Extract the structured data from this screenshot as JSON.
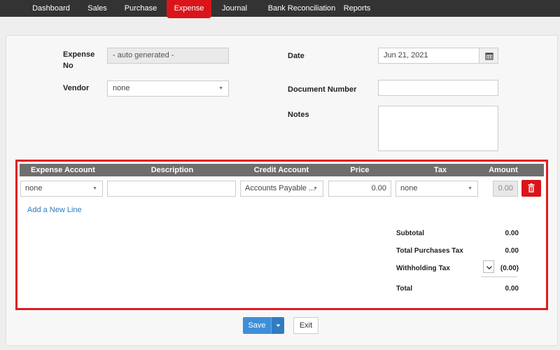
{
  "nav": {
    "items": [
      "Dashboard",
      "Sales",
      "Purchase",
      "Expense",
      "Journal",
      "Bank Reconciliation",
      "Reports"
    ],
    "active": "Expense",
    "active_color": "#d9151b",
    "bar_color": "#333333"
  },
  "form": {
    "expense_no_label": "Expense No",
    "expense_no_value": "- auto generated -",
    "vendor_label": "Vendor",
    "vendor_value": "none",
    "date_label": "Date",
    "date_value": "Jun 21, 2021",
    "document_number_label": "Document Number",
    "document_number_value": "",
    "notes_label": "Notes",
    "notes_value": "",
    "calendar_icon": "calendar-icon"
  },
  "lines": {
    "headers": [
      "Expense Account",
      "Description",
      "Credit Account",
      "Price",
      "Tax",
      "Amount"
    ],
    "row": {
      "expense_account": "none",
      "description": "",
      "credit_account": "Accounts Payable ...",
      "price": "0.00",
      "tax": "none",
      "amount": "0.00"
    },
    "delete_icon": "trash-icon",
    "add_line_label": "Add a New Line",
    "highlight_color": "#e01a22"
  },
  "summary": {
    "subtotal_label": "Subtotal",
    "subtotal_value": "0.00",
    "purchase_tax_label": "Total Purchases Tax",
    "purchase_tax_value": "0.00",
    "withholding_label": "Withholding Tax",
    "withholding_value": "(0.00)",
    "total_label": "Total",
    "total_value": "0.00"
  },
  "actions": {
    "save_label": "Save",
    "exit_label": "Exit",
    "save_color": "#3d8fd9"
  }
}
